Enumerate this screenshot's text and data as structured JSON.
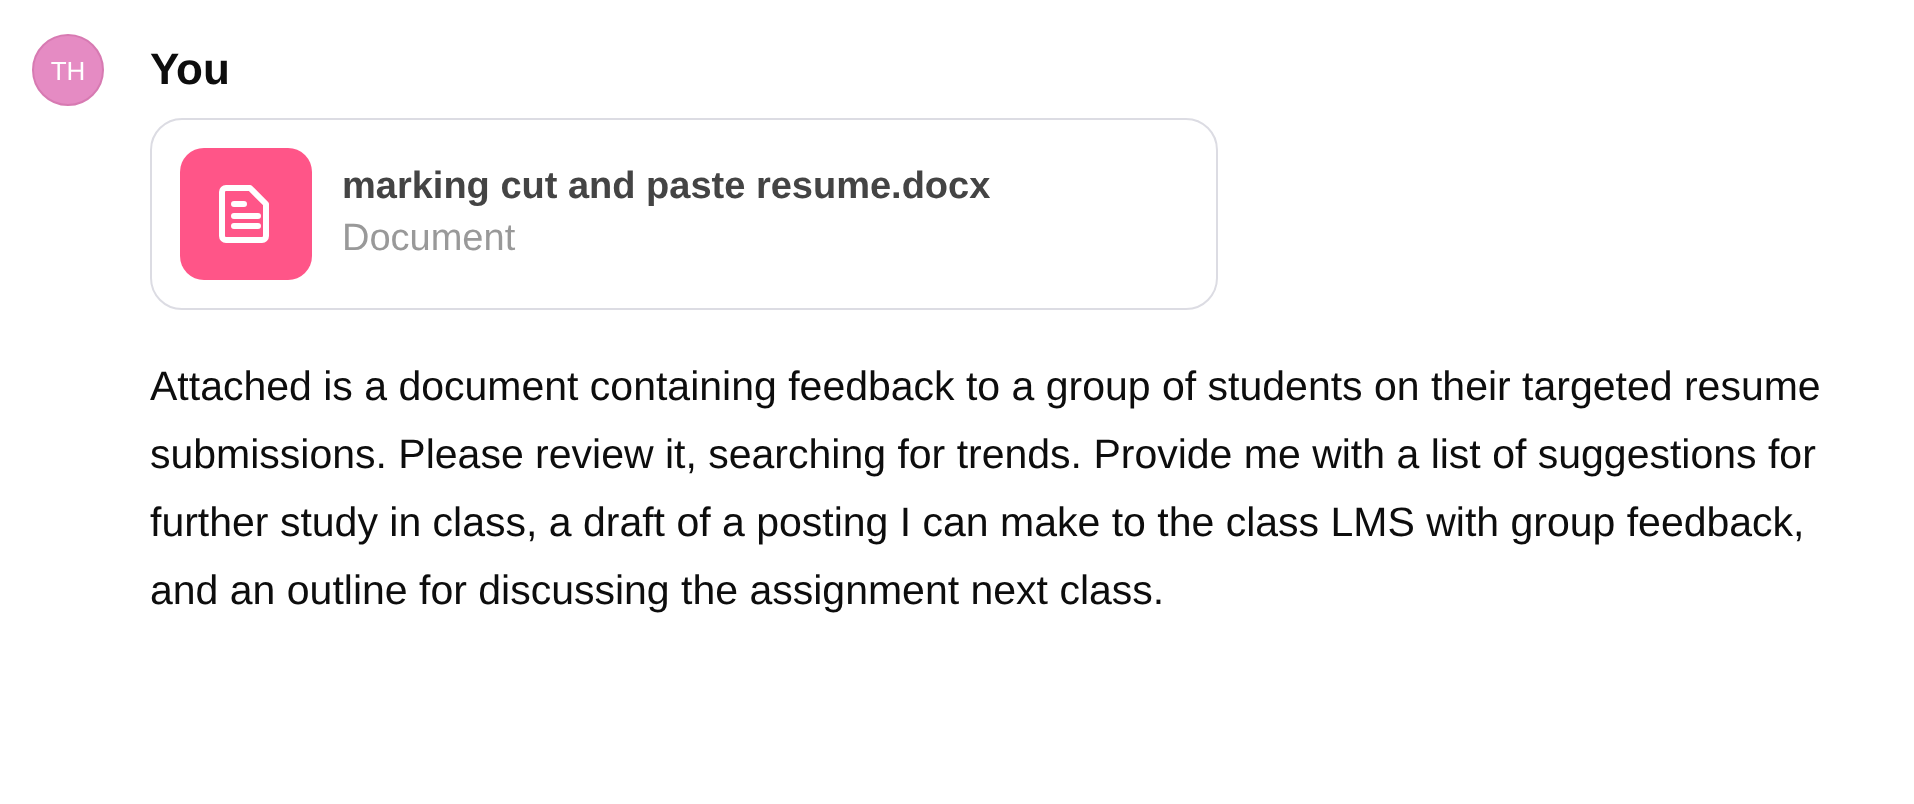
{
  "message": {
    "avatar": "TH",
    "author": "You",
    "attachment": {
      "name": "marking cut and paste resume.docx",
      "type": "Document"
    },
    "text": "Attached is a document containing feedback to a group of students on their targeted resume submissions. Please review it, searching for trends. Provide me with a list of suggestions for further study in class, a draft of a posting I can make to the class LMS with group feedback, and an outline for discussing the assignment next class."
  }
}
